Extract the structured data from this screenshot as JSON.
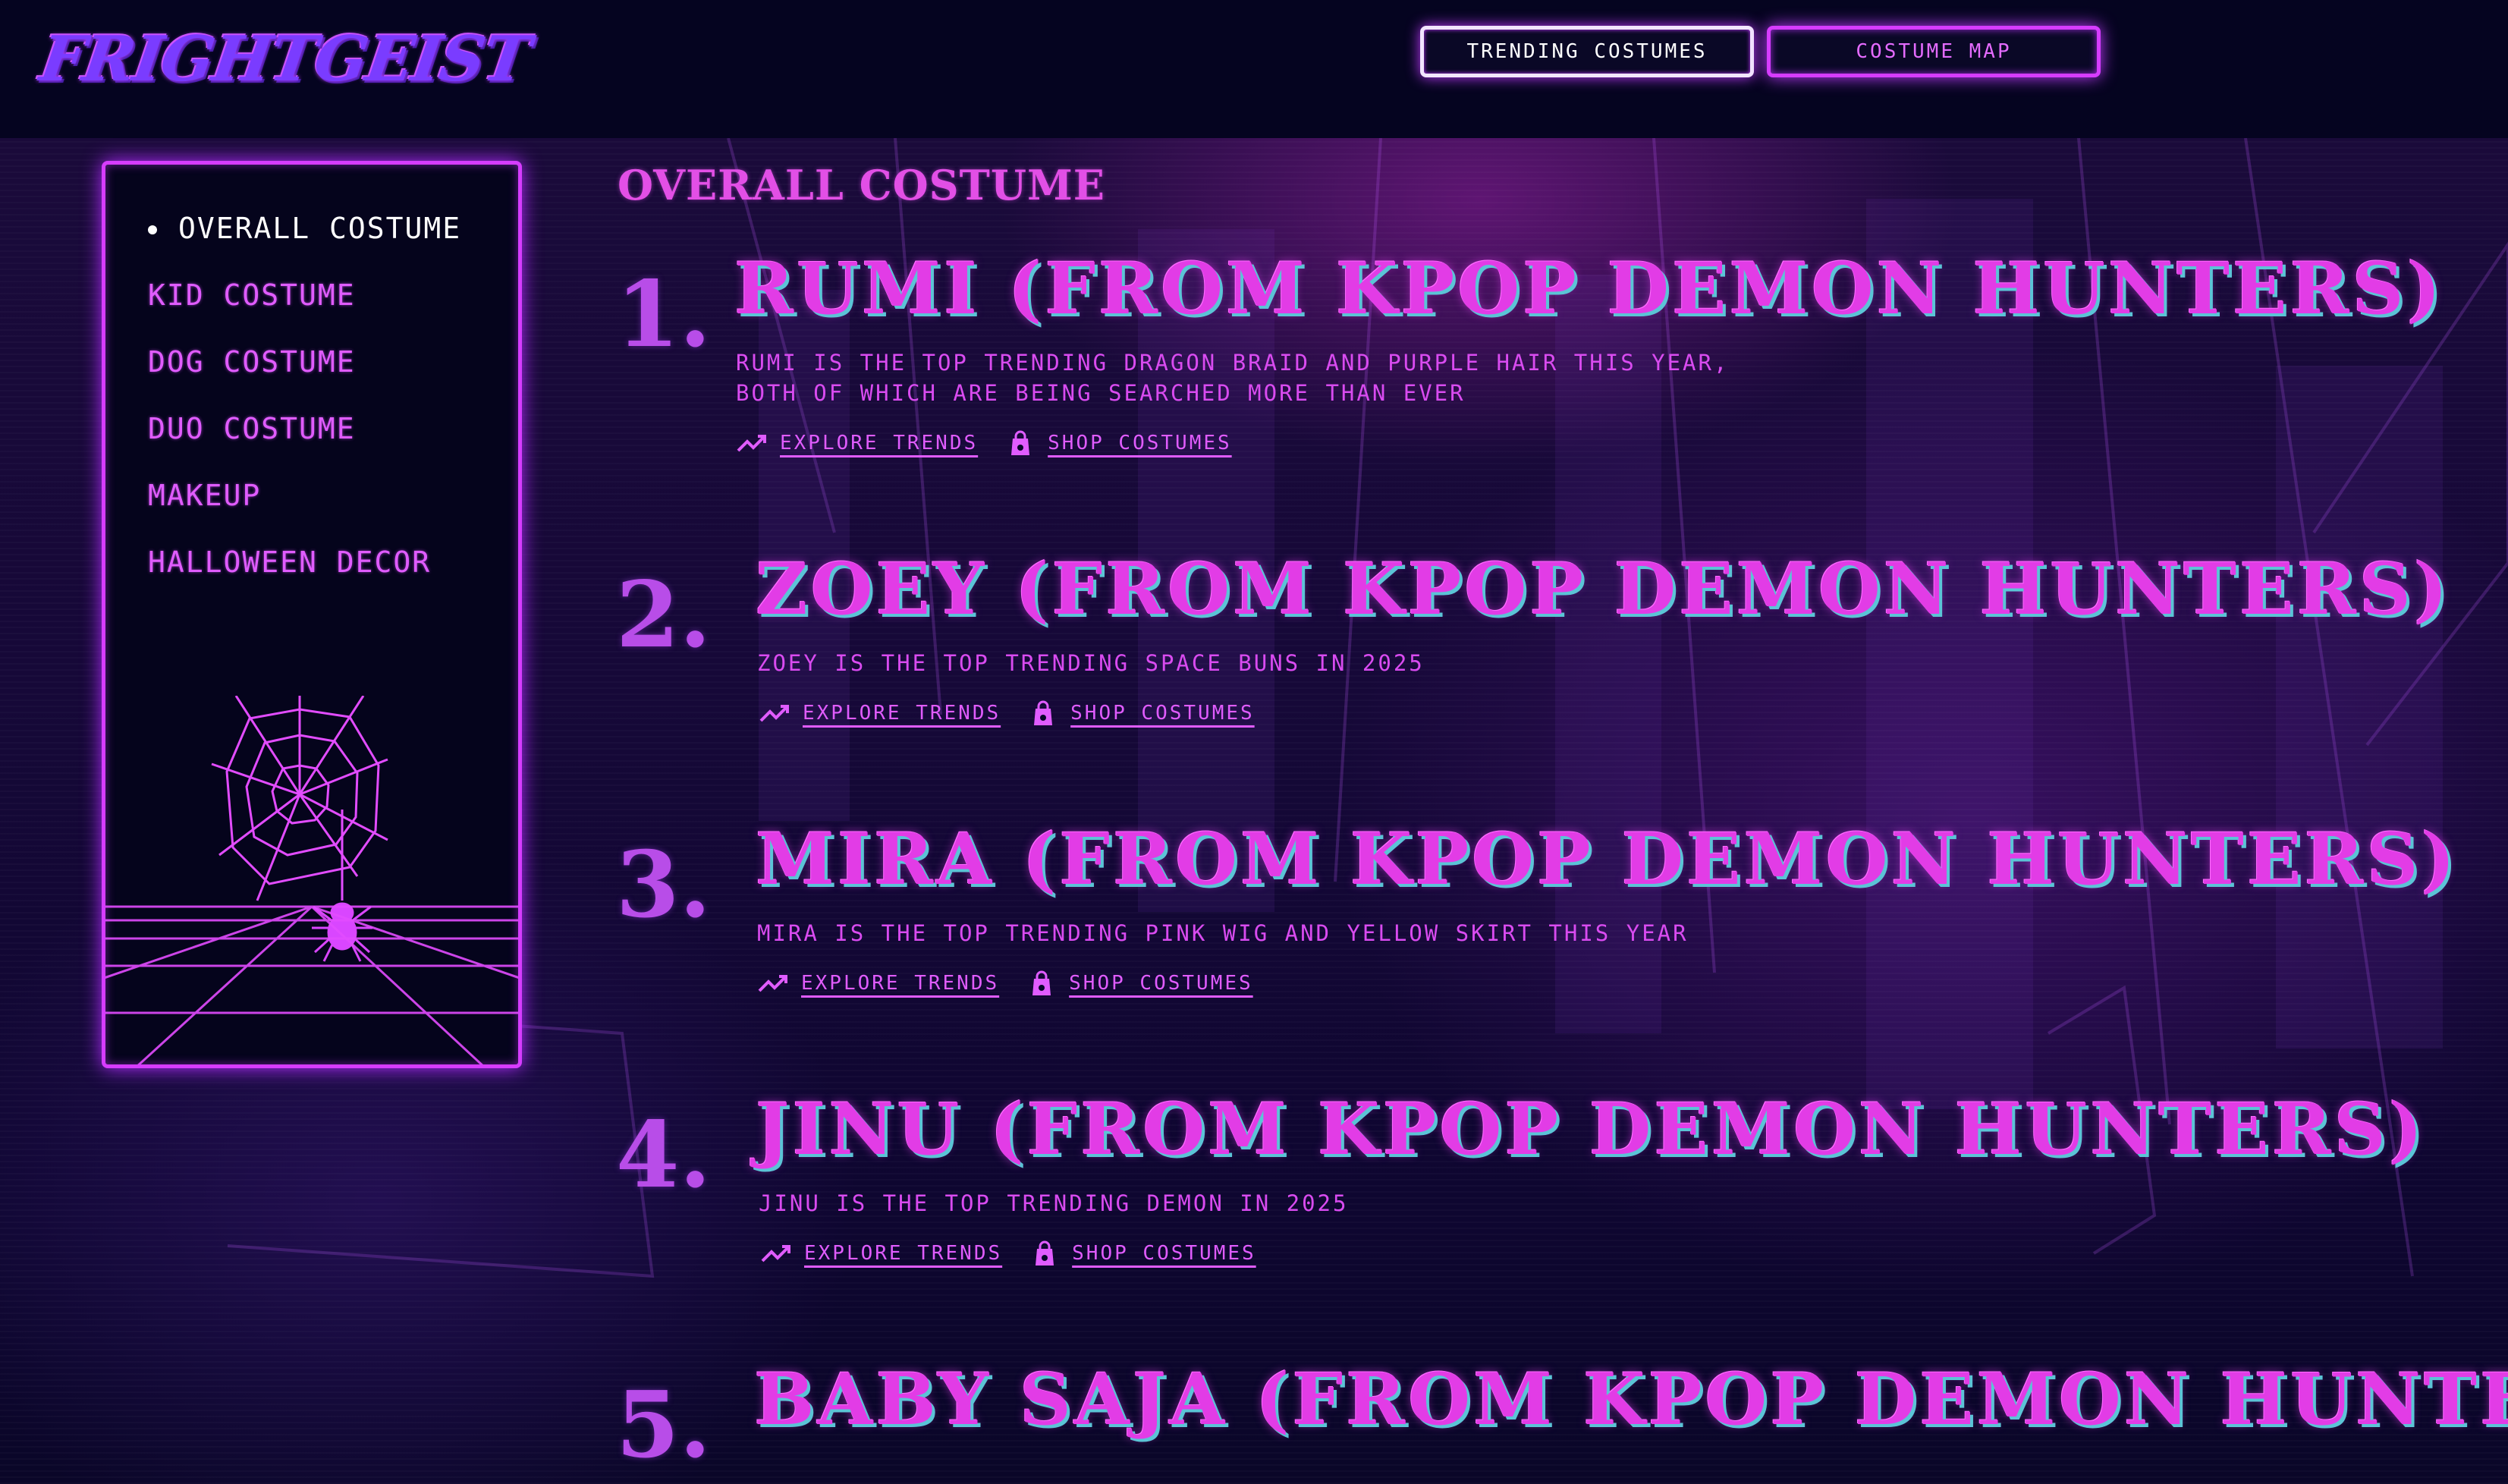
{
  "header": {
    "logo_text": "FRIGHTGEIST",
    "nav": {
      "trending_label": "TRENDING COSTUMES",
      "map_label": "COSTUME MAP"
    }
  },
  "sidebar": {
    "items": [
      {
        "label": "OVERALL COSTUME",
        "active": true
      },
      {
        "label": "KID COSTUME",
        "active": false
      },
      {
        "label": "DOG COSTUME",
        "active": false
      },
      {
        "label": "DUO COSTUME",
        "active": false
      },
      {
        "label": "MAKEUP",
        "active": false
      },
      {
        "label": "HALLOWEEN DECOR",
        "active": false
      }
    ]
  },
  "main": {
    "section_title": "OVERALL COSTUME",
    "items": [
      {
        "rank": "1.",
        "title": "RUMI (FROM KPOP DEMON HUNTERS)",
        "desc_lines": [
          "RUMI IS THE TOP TRENDING DRAGON BRAID AND PURPLE HAIR THIS YEAR,",
          "BOTH OF WHICH ARE BEING SEARCHED MORE THAN EVER"
        ],
        "explore_label": "EXPLORE TRENDS",
        "shop_label": "SHOP COSTUMES"
      },
      {
        "rank": "2.",
        "title": "ZOEY (FROM KPOP DEMON HUNTERS)",
        "desc_lines": [
          "ZOEY IS THE TOP TRENDING SPACE BUNS IN 2025"
        ],
        "explore_label": "EXPLORE TRENDS",
        "shop_label": "SHOP COSTUMES"
      },
      {
        "rank": "3.",
        "title": "MIRA (FROM KPOP DEMON HUNTERS)",
        "desc_lines": [
          "MIRA IS THE TOP TRENDING PINK WIG AND YELLOW SKIRT THIS YEAR"
        ],
        "explore_label": "EXPLORE TRENDS",
        "shop_label": "SHOP COSTUMES"
      },
      {
        "rank": "4.",
        "title": "JINU (FROM KPOP DEMON HUNTERS)",
        "desc_lines": [
          "JINU IS THE TOP TRENDING DEMON IN 2025"
        ],
        "explore_label": "EXPLORE TRENDS",
        "shop_label": "SHOP COSTUMES"
      },
      {
        "rank": "5.",
        "title": "BABY SAJA (FROM KPOP DEMON HUNTERS)",
        "desc_lines": [],
        "explore_label": "",
        "shop_label": ""
      }
    ]
  },
  "icons": {
    "logo": "frightgeist-logo",
    "explore": "trend-arrow-icon",
    "shop": "shopping-bag-icon",
    "sidebar_art": "spider-web-icon"
  },
  "colors": {
    "accent_magenta": "#d63cff",
    "title_pink": "#e23ce6",
    "title_shadow_cyan": "#5bc4d6",
    "background": "#070626"
  }
}
